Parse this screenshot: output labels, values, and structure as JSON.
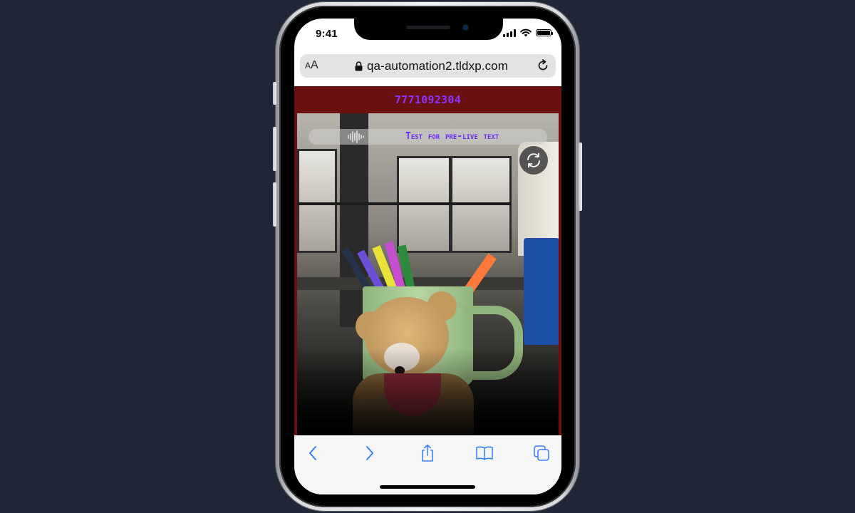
{
  "status_bar": {
    "time": "9:41"
  },
  "address_bar": {
    "text_size_small": "A",
    "text_size_big": "A",
    "url": "qa-automation2.tldxp.com"
  },
  "page": {
    "phone_number": "7771092304",
    "caption": "Test for pre-live text"
  },
  "toolbar": {
    "icons": [
      "back-icon",
      "forward-icon",
      "share-icon",
      "bookmarks-icon",
      "tabs-icon"
    ]
  },
  "colors": {
    "background": "#222738",
    "header_bg": "#6b1010",
    "accent_text": "#6d2cff",
    "ios_blue": "#3b82f6"
  }
}
